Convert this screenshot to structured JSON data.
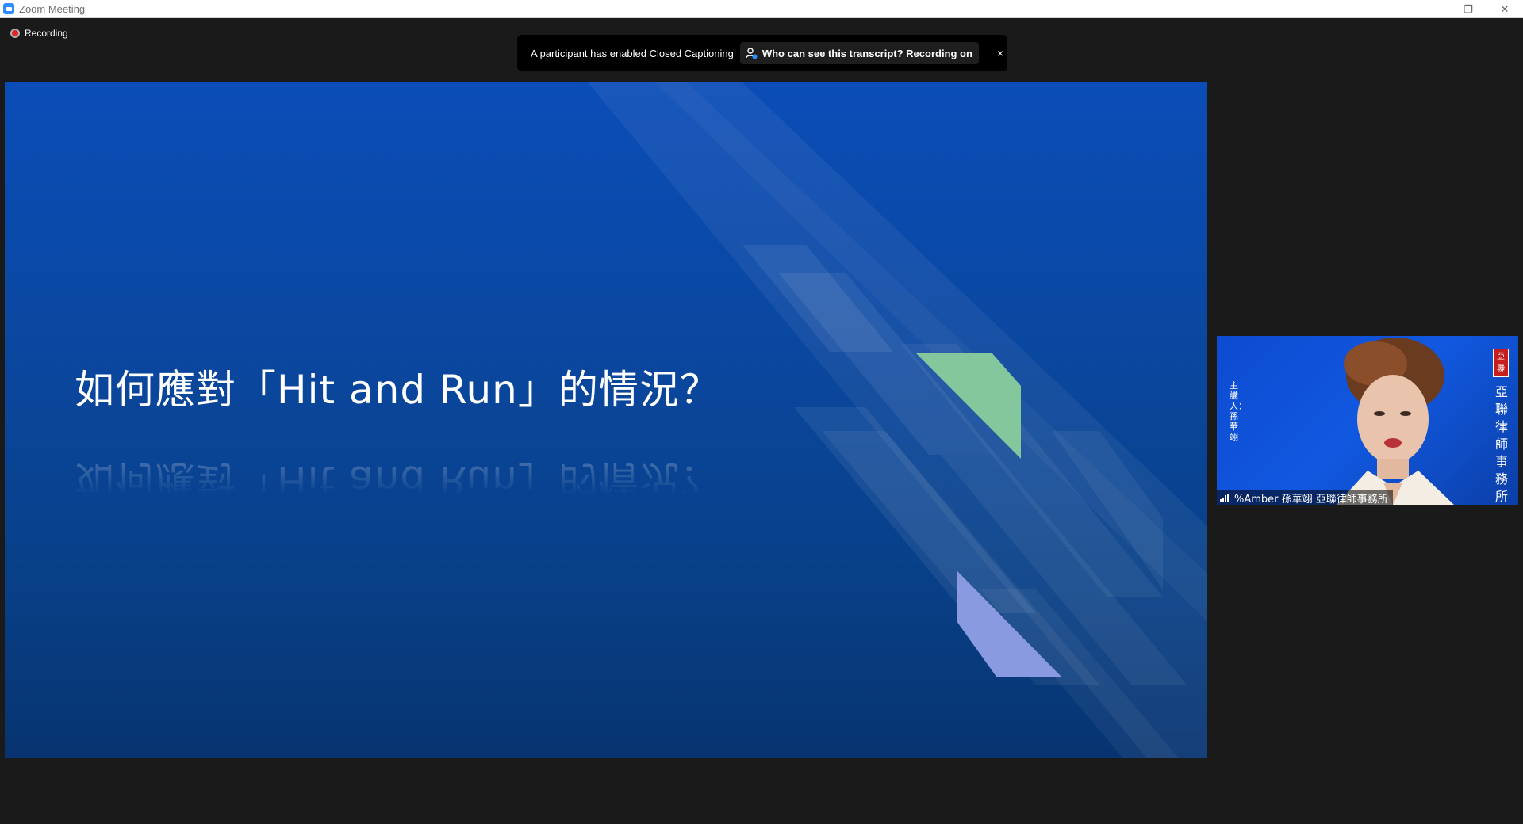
{
  "window": {
    "title": "Zoom Meeting",
    "minimize_glyph": "—",
    "restore_glyph": "❐",
    "close_glyph": "✕"
  },
  "recording": {
    "label": "Recording",
    "dot_color": "#e02828"
  },
  "caption_banner": {
    "message": "A participant has enabled Closed Captioning",
    "link_text": "Who can see this transcript? Recording on",
    "link_icon": "person-info-icon",
    "close_glyph": "×"
  },
  "slide": {
    "title": "如何應對「Hit and Run」的情況？",
    "accent_colors": {
      "green": "#85c79c",
      "lavender": "#8a9ae0"
    }
  },
  "participant": {
    "name": "%Amber 孫華翊 亞聯律師事務所",
    "signal_icon": "signal-strength-icon",
    "left_vertical_text": "主講人：孫華翊",
    "seal_text": "亞聯",
    "right_vertical_text": "亞聯律師事務所"
  }
}
